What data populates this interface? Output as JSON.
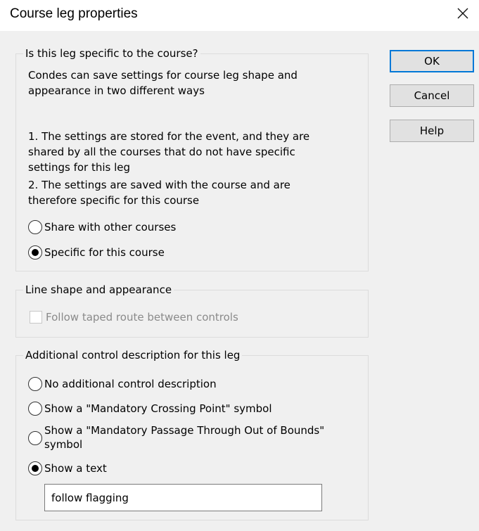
{
  "window": {
    "title": "Course leg properties"
  },
  "buttons": {
    "ok": "OK",
    "cancel": "Cancel",
    "help": "Help"
  },
  "group1": {
    "legend": "Is this leg specific to the course?",
    "intro_lines": [
      "Condes can save settings for course leg shape and",
      "appearance in two different ways"
    ],
    "detail_lines": [
      "1. The settings are stored for the event, and they are",
      "shared by all the courses that do not have specific",
      "settings for this leg",
      "2. The settings are saved with the course and are",
      "therefore specific for this course"
    ],
    "options": [
      {
        "label": "Share with other courses",
        "selected": false
      },
      {
        "label": "Specific for this course",
        "selected": true
      }
    ]
  },
  "group2": {
    "legend": "Line shape and appearance",
    "checkbox_label": "Follow taped route between controls",
    "checked": false,
    "enabled": false
  },
  "group3": {
    "legend": "Additional control description for this leg",
    "options": [
      {
        "label": "No additional control description",
        "selected": false
      },
      {
        "label": "Show a \"Mandatory Crossing Point\" symbol",
        "selected": false
      },
      {
        "label_lines": [
          "Show a \"Mandatory Passage Through Out of Bounds\"",
          "symbol"
        ],
        "selected": false
      },
      {
        "label": "Show a text",
        "selected": true
      }
    ],
    "text_value": "follow flagging"
  }
}
